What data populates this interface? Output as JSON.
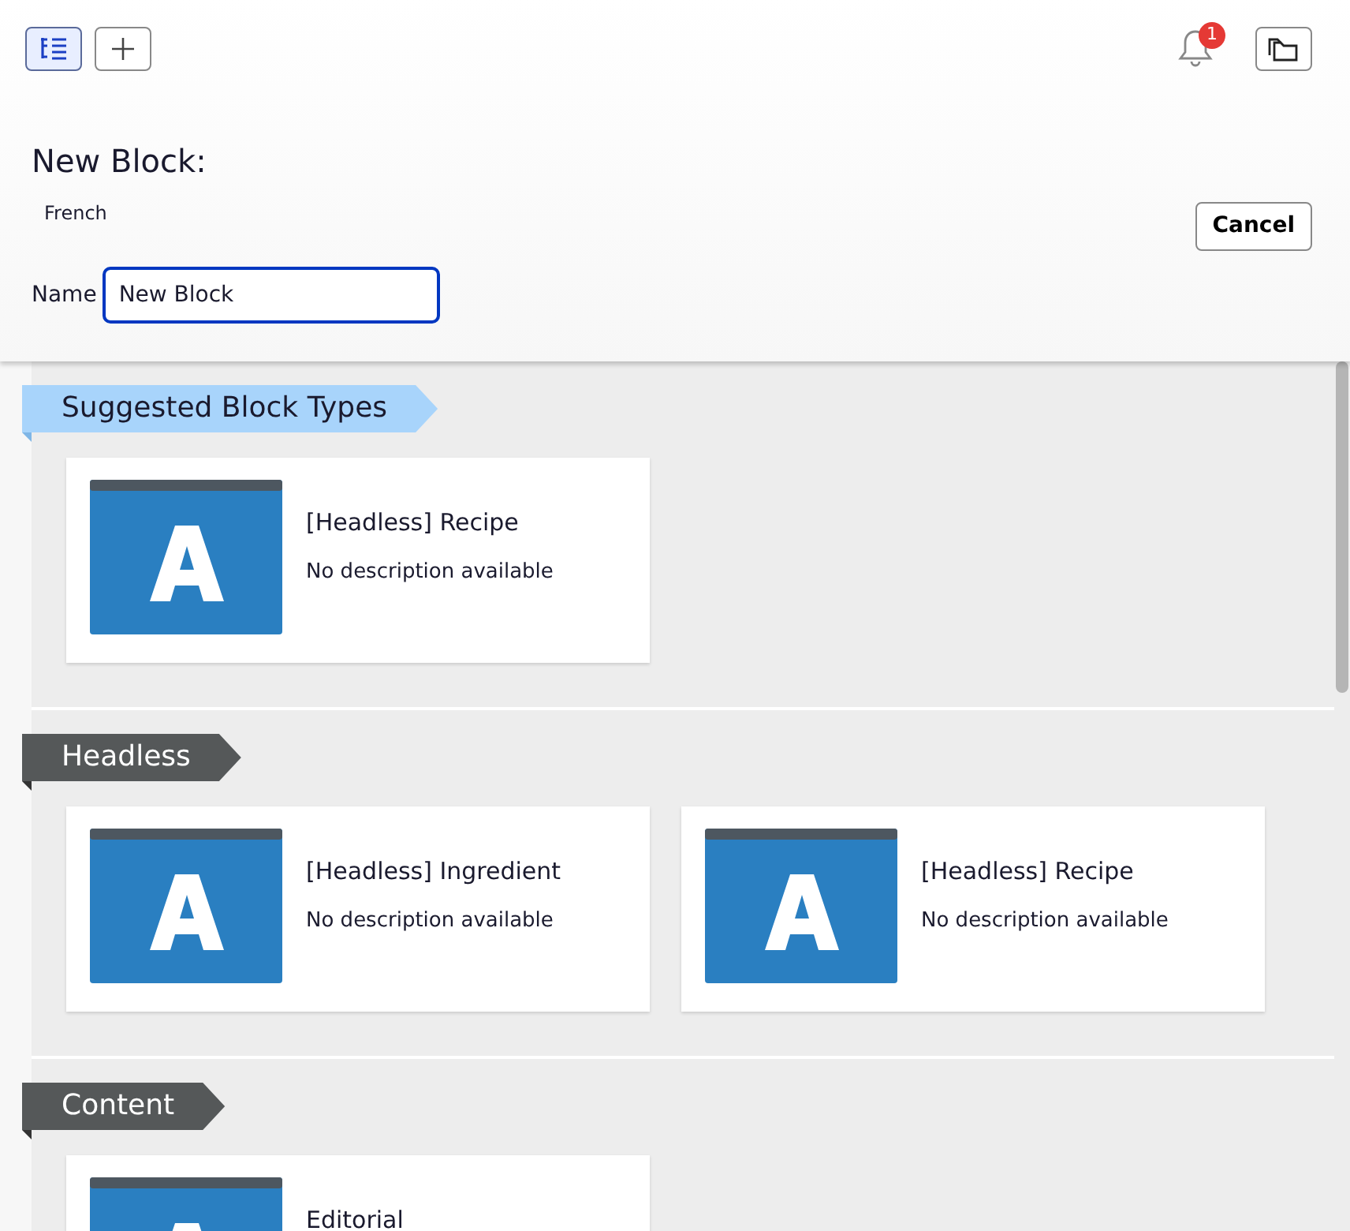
{
  "toolbar": {
    "tree_view_selected": true,
    "notification_count": "1"
  },
  "form": {
    "title": "New Block:",
    "language": "French",
    "cancel": "Cancel",
    "name_label": "Name",
    "name_value": "New Block"
  },
  "sections": [
    {
      "kind": "suggested",
      "title": "Suggested Block Types",
      "cards": [
        {
          "title": "[Headless] Recipe",
          "description": "No description available"
        }
      ]
    },
    {
      "kind": "group",
      "title": "Headless",
      "cards": [
        {
          "title": "[Headless] Ingredient",
          "description": "No description available"
        },
        {
          "title": "[Headless] Recipe",
          "description": "No description available"
        }
      ]
    },
    {
      "kind": "group",
      "title": "Content",
      "cards": [
        {
          "title": "Editorial"
        }
      ]
    }
  ]
}
